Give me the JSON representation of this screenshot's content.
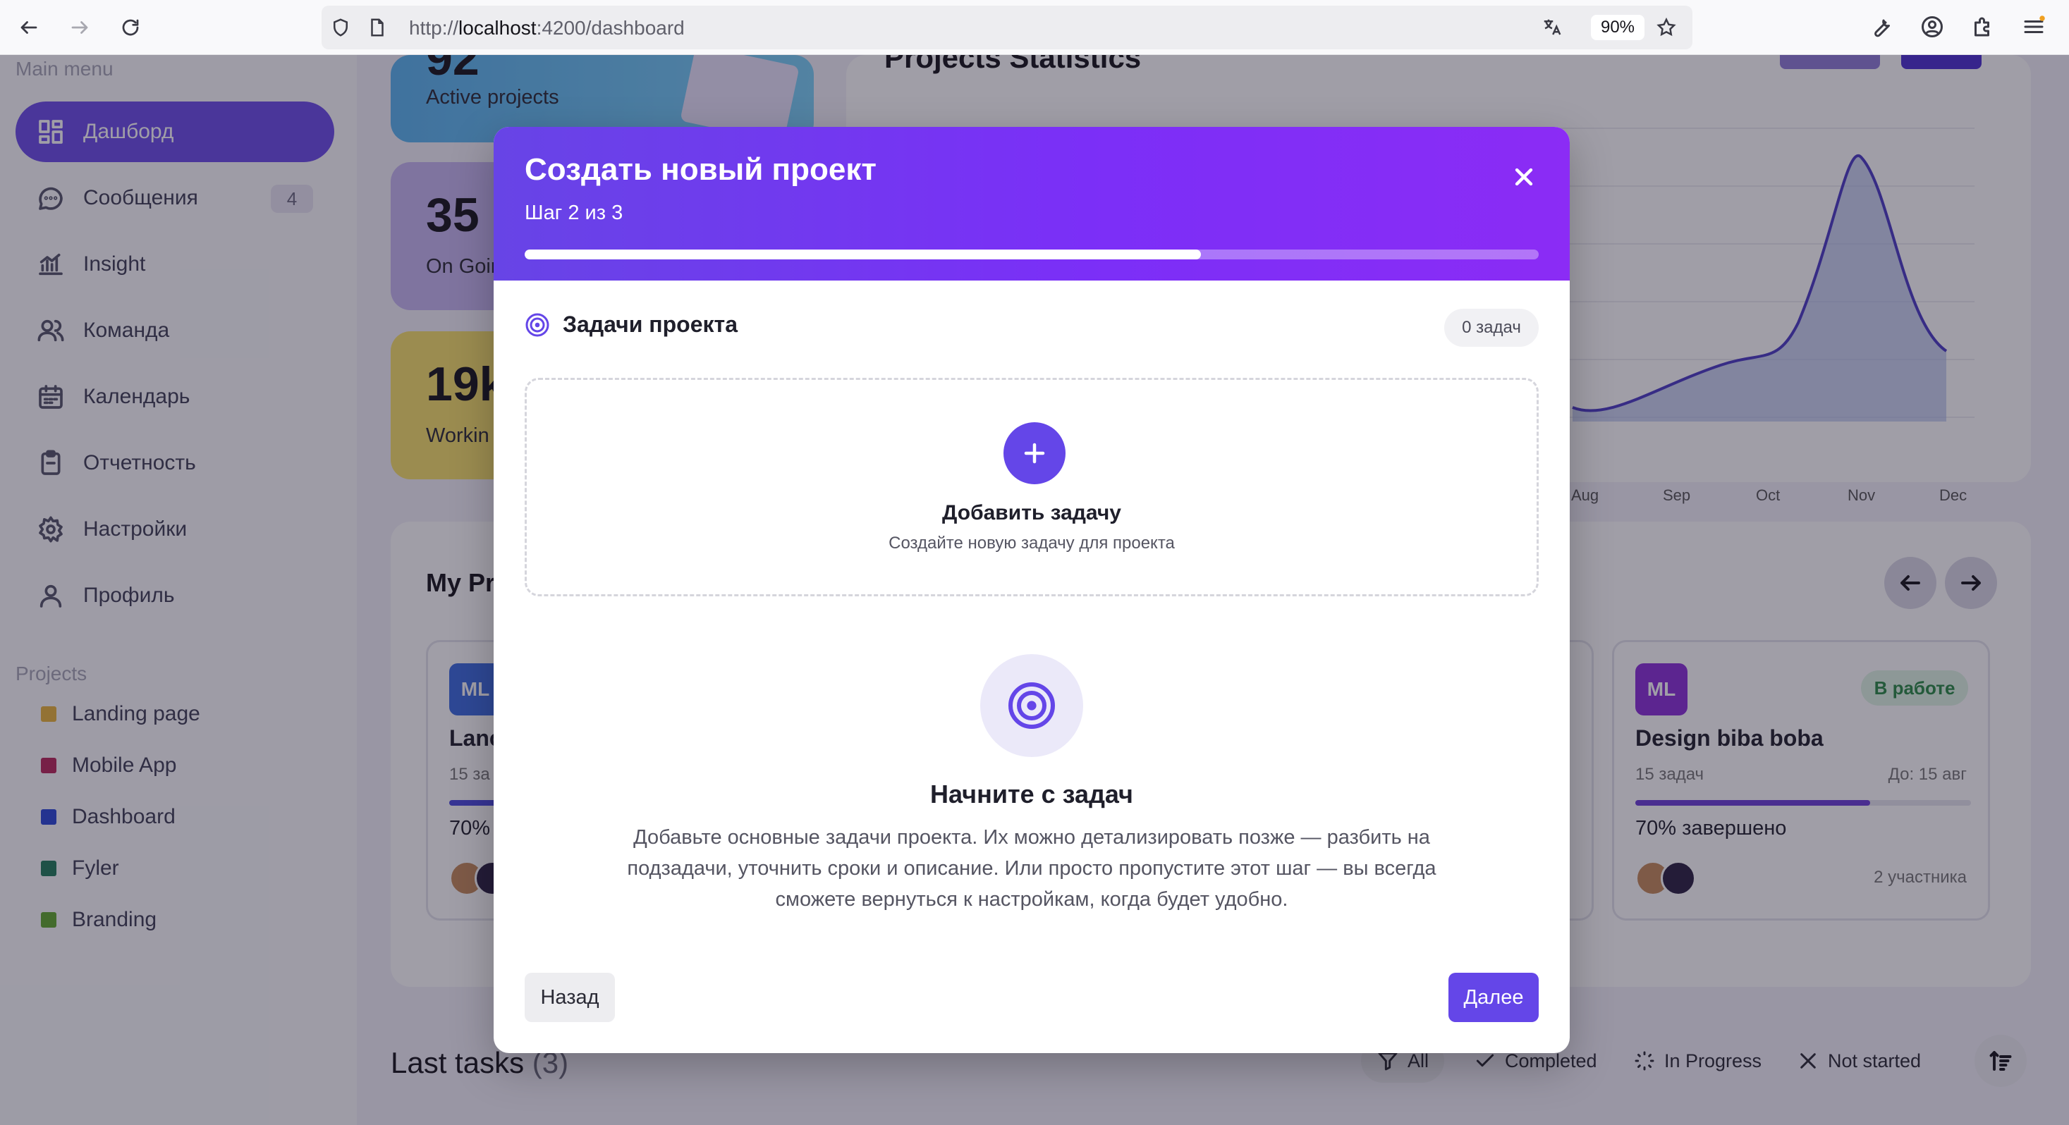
{
  "browser": {
    "url_prefix": "http://",
    "url_host": "localhost",
    "url_path": ":4200/dashboard",
    "zoom": "90%"
  },
  "sidebar": {
    "main_menu_label": "Main menu",
    "items": [
      {
        "label": "Дашборд",
        "icon": "dashboard-icon"
      },
      {
        "label": "Сообщения",
        "icon": "chat-icon",
        "badge": "4"
      },
      {
        "label": "Insight",
        "icon": "chart-icon"
      },
      {
        "label": "Команда",
        "icon": "users-icon"
      },
      {
        "label": "Календарь",
        "icon": "calendar-icon"
      },
      {
        "label": "Отчетность",
        "icon": "clipboard-icon"
      },
      {
        "label": "Настройки",
        "icon": "gear-icon"
      },
      {
        "label": "Профиль",
        "icon": "user-icon"
      }
    ],
    "projects_label": "Projects",
    "projects": [
      {
        "label": "Landing page",
        "color": "#e8b33a"
      },
      {
        "label": "Mobile App",
        "color": "#b8265a"
      },
      {
        "label": "Dashboard",
        "color": "#2a48d8"
      },
      {
        "label": "Fyler",
        "color": "#1f7a5a"
      },
      {
        "label": "Branding",
        "color": "#5fa82c"
      }
    ]
  },
  "main": {
    "stats": [
      {
        "value": "92",
        "label": "Active projects"
      },
      {
        "value": "35",
        "label": "On Goir"
      },
      {
        "value": "19k",
        "label": "Workin"
      }
    ],
    "statistics_title": "Projects Statistics",
    "chart_months": [
      "Aug",
      "Sep",
      "Oct",
      "Nov",
      "Dec"
    ],
    "my_projects_title": "My Pr",
    "card_left": {
      "badge": "ML",
      "title": "Lanc",
      "tasks": "15 за",
      "progress": "70%"
    },
    "card_right": {
      "badge": "ML",
      "status": "В работе",
      "title": "Design biba boba",
      "tasks": "15 задач",
      "due": "До: 15 авг",
      "progress_text": "70% завершено",
      "progress": 0.7,
      "members": "2 участника"
    },
    "last_tasks_title": "Last tasks",
    "last_tasks_count": "(3)",
    "filters": [
      "All",
      "Completed",
      "In Progress",
      "Not started"
    ]
  },
  "modal": {
    "title": "Создать новый проект",
    "step": "Шаг 2 из 3",
    "progress": 0.667,
    "section_title": "Задачи проекта",
    "task_count": "0 задач",
    "add_task_title": "Добавить задачу",
    "add_task_subtitle": "Создайте новую задачу для проекта",
    "empty_title": "Начните с задач",
    "empty_description": "Добавьте основные задачи проекта. Их можно детализировать позже — разбить на подзадачи, уточнить сроки и описание. Или просто пропустите этот шаг — вы всегда сможете вернуться к настройкам, когда будет удобно.",
    "back_label": "Назад",
    "next_label": "Далее"
  },
  "colors": {
    "accent": "#6446e8",
    "header_start": "#6744e6",
    "header_end": "#8b2cf5"
  }
}
